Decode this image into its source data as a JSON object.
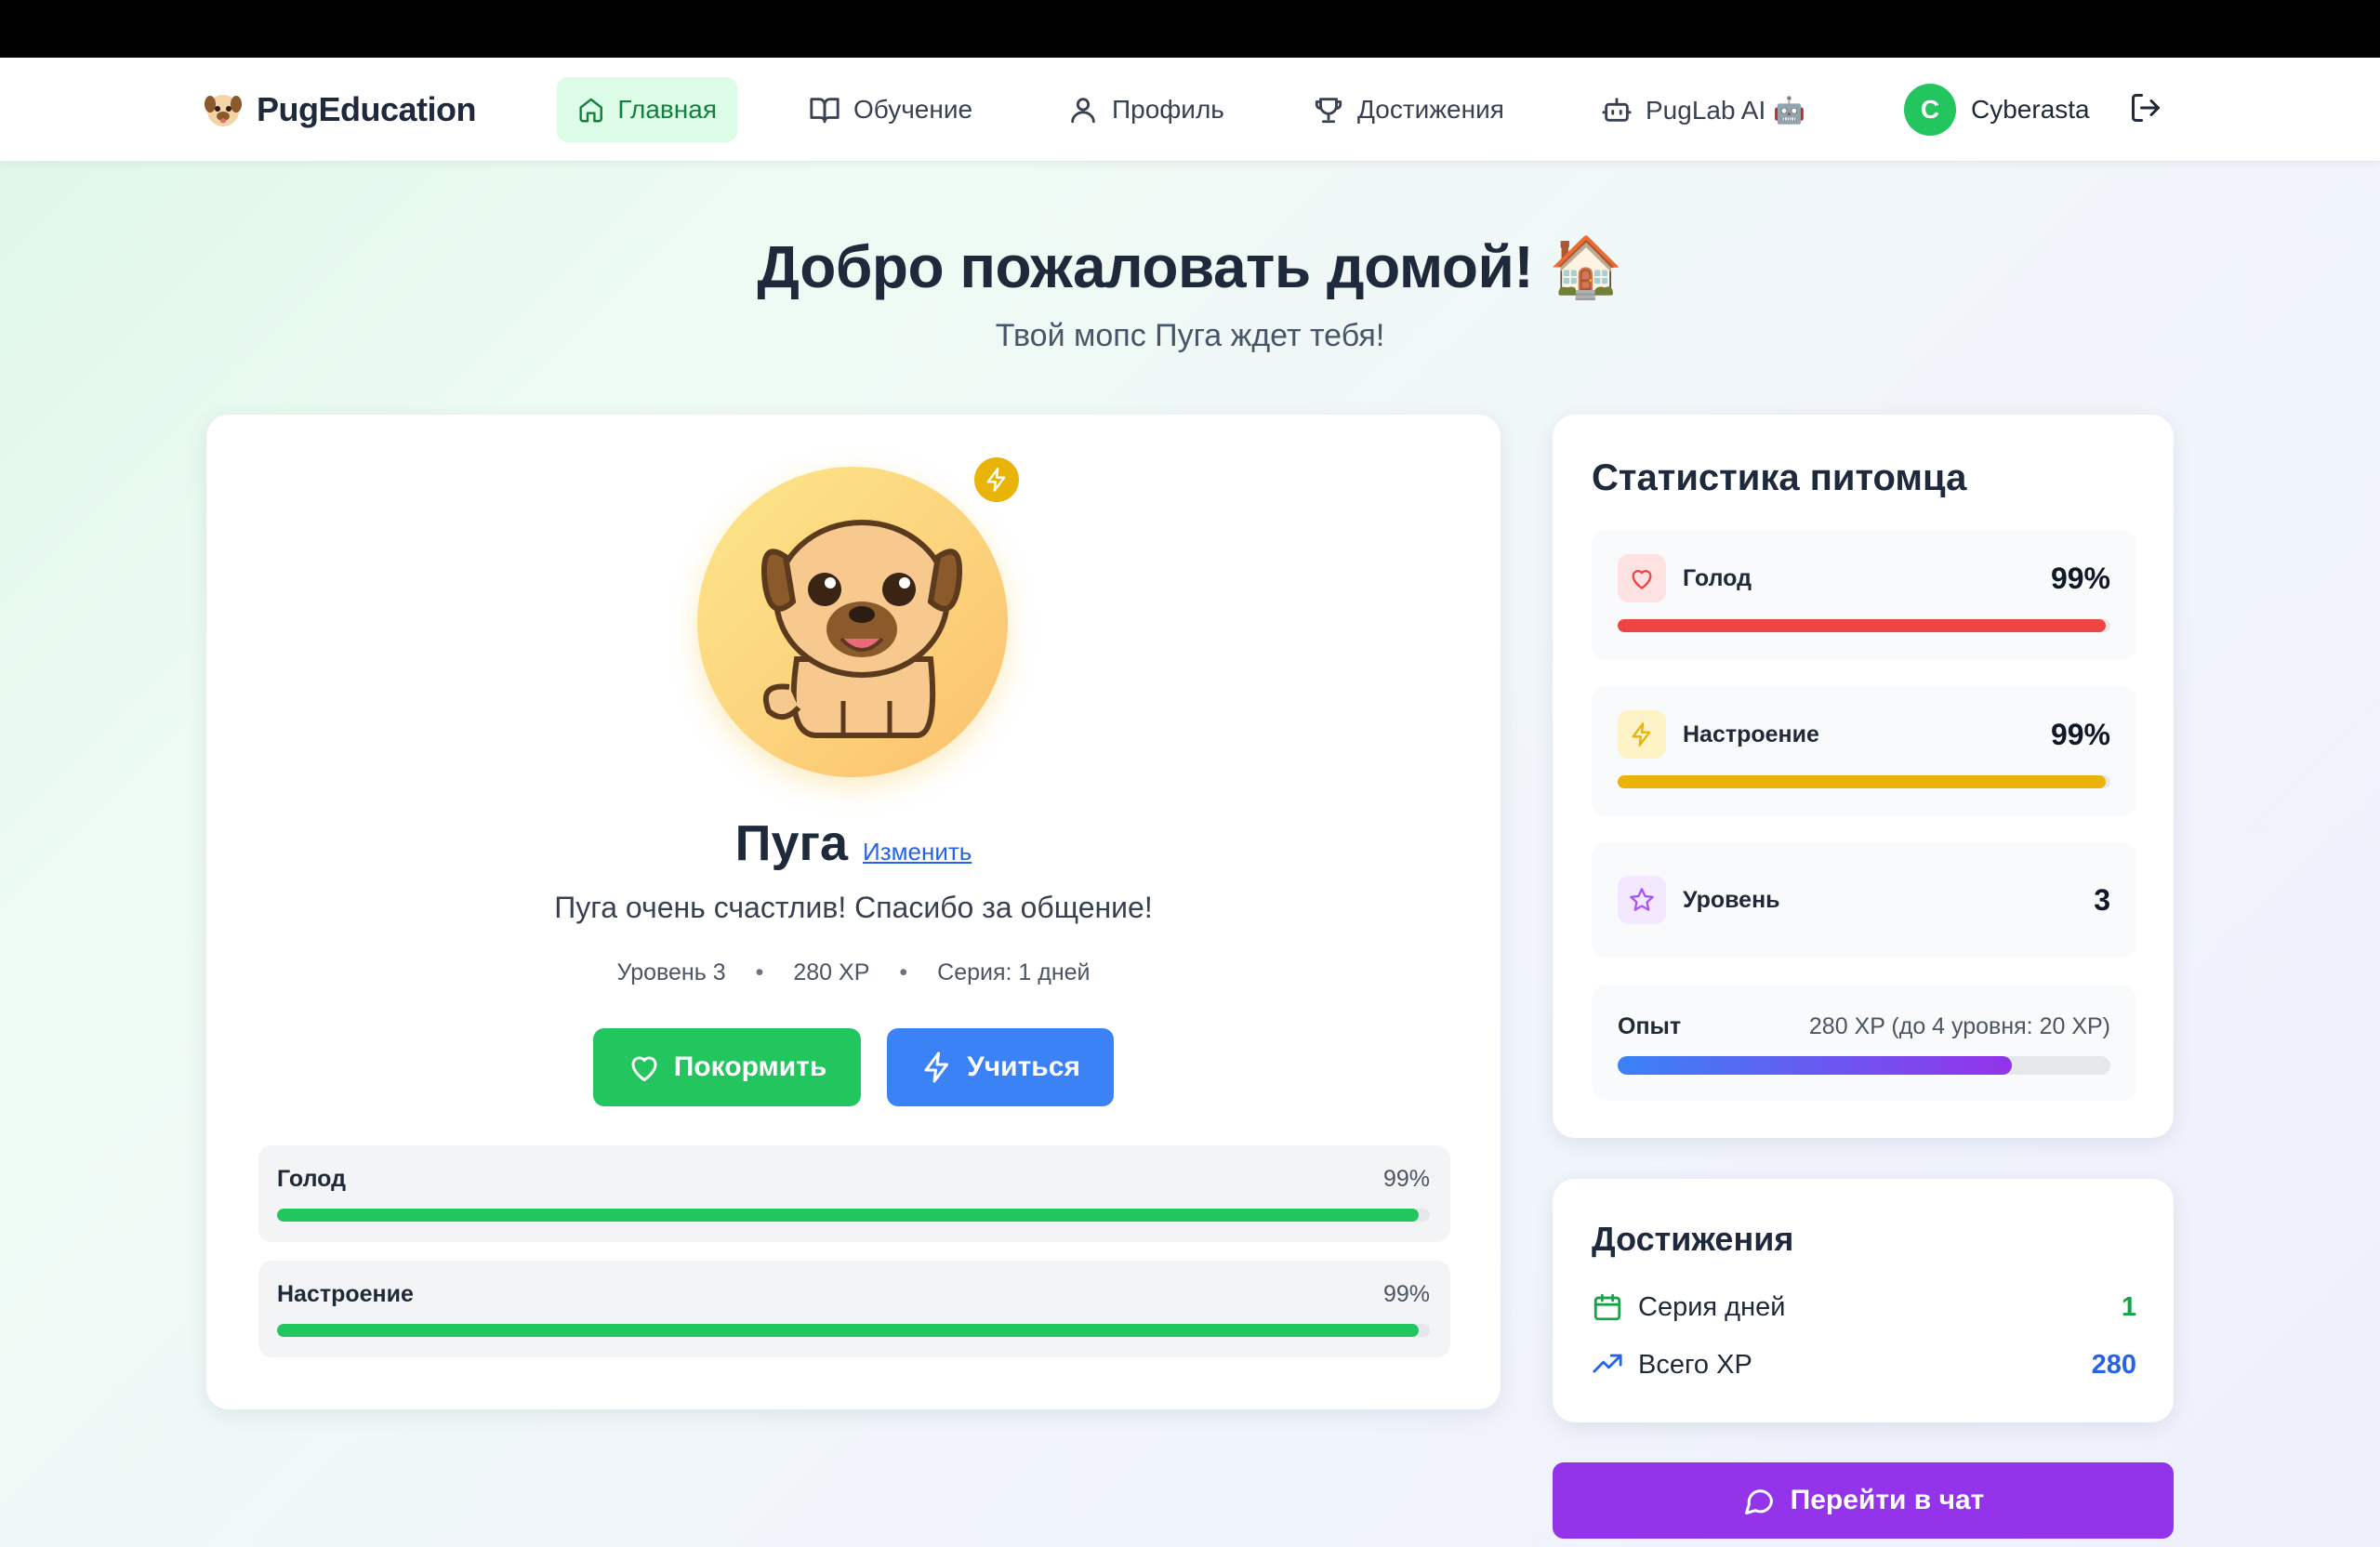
{
  "app": {
    "brand": "PugEducation"
  },
  "nav": {
    "items": [
      {
        "label": "Главная",
        "icon": "home-icon",
        "active": true
      },
      {
        "label": "Обучение",
        "icon": "book-icon",
        "active": false
      },
      {
        "label": "Профиль",
        "icon": "user-icon",
        "active": false
      },
      {
        "label": "Достижения",
        "icon": "trophy-icon",
        "active": false
      },
      {
        "label": "PugLab AI 🤖",
        "icon": "bot-icon",
        "active": false
      }
    ],
    "user": {
      "initial": "C",
      "name": "Cyberasta"
    }
  },
  "hero": {
    "title": "Добро пожаловать домой! 🏠",
    "subtitle": "Твой мопс Пуга ждет тебя!"
  },
  "pet": {
    "name": "Пуга",
    "rename_label": "Изменить",
    "mood": "Пуга очень счастлив! Спасибо за общение!",
    "meta": {
      "level": "Уровень 3",
      "sep1": "•",
      "xp": "280 XP",
      "sep2": "•",
      "streak": "Серия: 1 дней"
    },
    "buttons": {
      "feed": "Покормить",
      "learn": "Учиться"
    },
    "stats": [
      {
        "label": "Голод",
        "value": "99%",
        "fraction": 0.99,
        "color": "#22c55e"
      },
      {
        "label": "Настроение",
        "value": "99%",
        "fraction": 0.99,
        "color": "#22c55e"
      }
    ]
  },
  "pet_stats": {
    "title": "Статистика питомца",
    "hunger": {
      "label": "Голод",
      "value": "99%",
      "fraction": 0.99,
      "color": "#ef4444",
      "icon": "heart-icon"
    },
    "mood": {
      "label": "Настроение",
      "value": "99%",
      "fraction": 0.99,
      "color": "#eab308",
      "icon": "bolt-icon"
    },
    "level": {
      "label": "Уровень",
      "value": "3",
      "icon": "star-icon"
    },
    "xp": {
      "label": "Опыт",
      "value": "280 XP (до 4 уровня: 20 XP)",
      "fraction": 0.8
    }
  },
  "achievements": {
    "title": "Достижения",
    "items": [
      {
        "label": "Серия дней",
        "value": "1",
        "color": "#16a34a",
        "icon": "calendar-icon"
      },
      {
        "label": "Всего XP",
        "value": "280",
        "color": "#2563eb",
        "icon": "trending-up-icon"
      }
    ]
  },
  "chat": {
    "label": "Перейти в чат",
    "icon": "chat-bubble-icon"
  },
  "colors": {
    "accent_green": "#22c55e",
    "accent_blue": "#3b82f6",
    "accent_purple": "#9333ea",
    "accent_yellow": "#eab308",
    "accent_red": "#ef4444"
  }
}
